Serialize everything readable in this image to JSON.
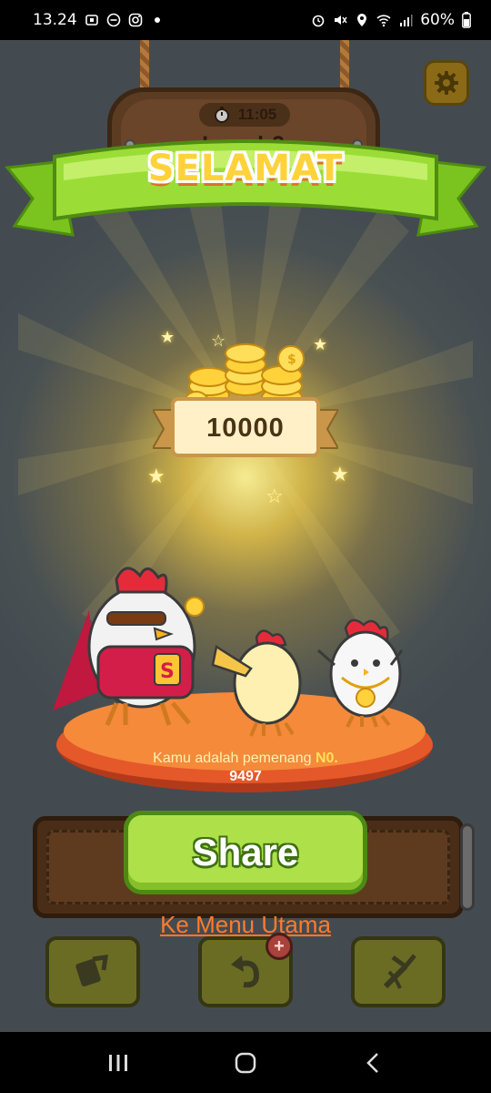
{
  "status_bar": {
    "time": "13.24",
    "battery": "60%",
    "icons_left": [
      "screenshot-icon",
      "dnd-icon",
      "instagram-icon",
      "dot-icon"
    ],
    "icons_right": [
      "alarm-icon",
      "mute-icon",
      "location-icon",
      "wifi-icon",
      "signal-icon"
    ]
  },
  "header": {
    "timer": "11:05",
    "level": "Level  2",
    "settings_icon": "gear-icon"
  },
  "banner": {
    "title": "SELAMAT"
  },
  "reward": {
    "amount": "10000"
  },
  "winner": {
    "text": "Kamu adalah pemenang ",
    "highlight": "N0.",
    "number": "9497"
  },
  "actions": {
    "share": "Share",
    "main_menu": "Ke Menu Utama"
  },
  "toolbar": {
    "tools": [
      "shuffle-icon",
      "undo-icon",
      "magic-icon"
    ],
    "badge": "+"
  },
  "colors": {
    "background": "#434b51",
    "ribbon_green": "#8ed42a",
    "title_yellow": "#ffd23c",
    "share_green": "#aee04a",
    "link_orange": "#ff7a2a",
    "stage_orange": "#f58a3a"
  }
}
